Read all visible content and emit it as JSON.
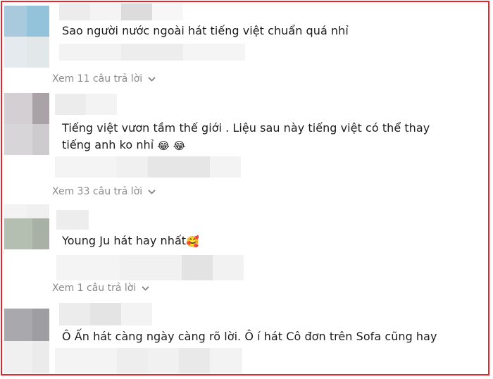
{
  "comments": [
    {
      "text": "Sao người nước ngoài hát tiếng việt chuẩn quá nhỉ",
      "replies_label": "Xem 11 câu trả lời"
    },
    {
      "text_line1": "Tiếng việt vươn tầm thế giới . Liệu sau này tiếng việt có thể thay",
      "text_line2": "tiếng anh ko nhỉ",
      "emojis": "😂 😂",
      "replies_label": "Xem 33 câu trả lời"
    },
    {
      "text": "Young Ju hát hay nhất",
      "emoji": "🥰",
      "replies_label": "Xem 1 câu trả lời"
    },
    {
      "text": "Ô Ấn hát càng ngày càng rõ lời. Ô í hát Cô đơn trên Sofa cũng hay"
    }
  ],
  "icons": {
    "expand": "chevron-down-icon"
  },
  "colors": {
    "frame_border": "#e8262a",
    "text": "#1c1c1c",
    "muted": "#8a8a8a"
  }
}
